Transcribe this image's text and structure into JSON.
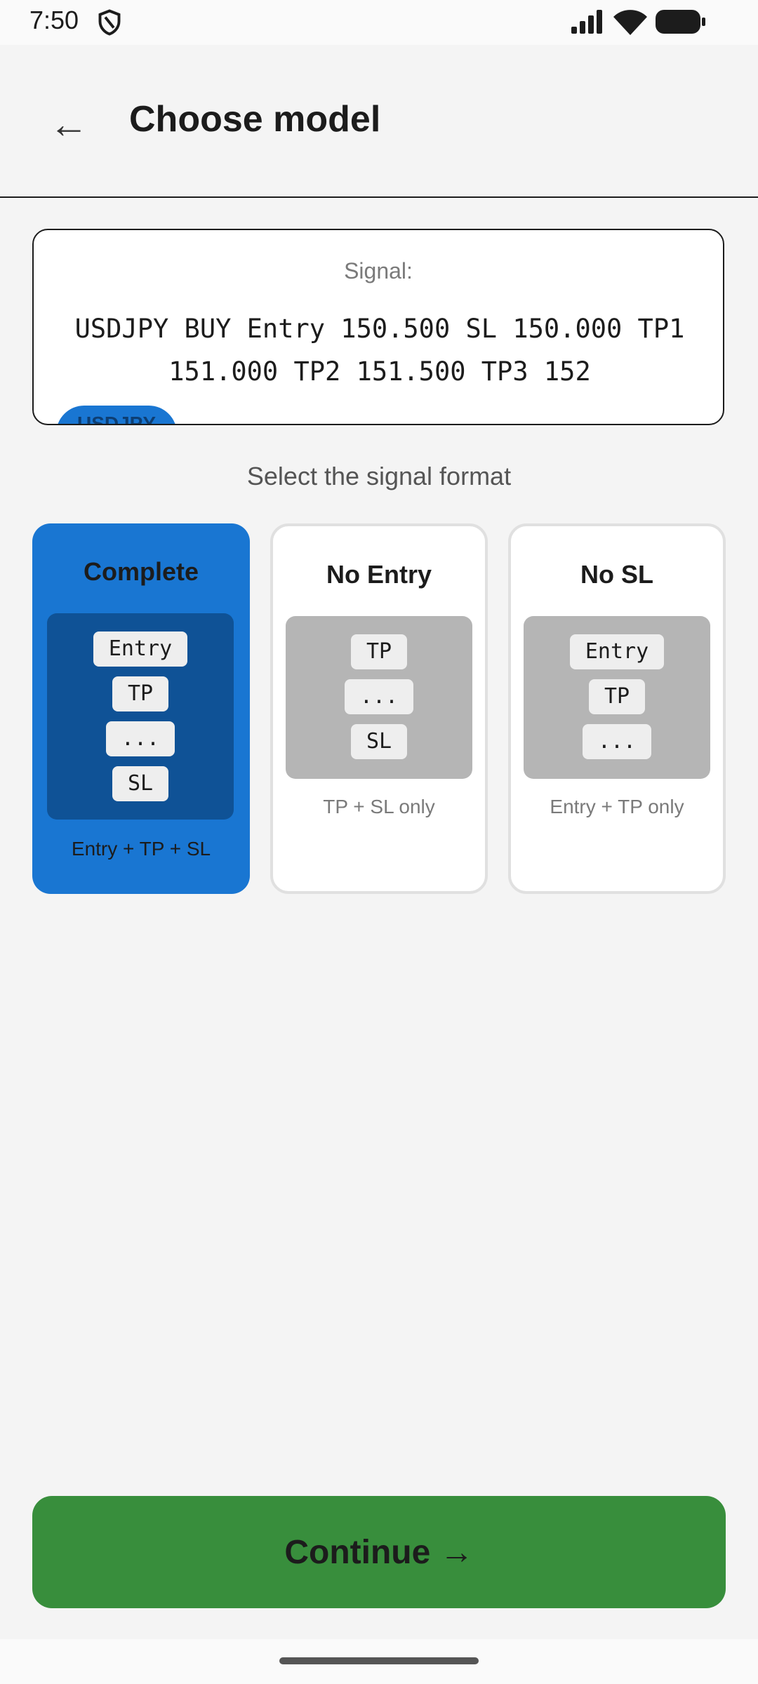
{
  "status_bar": {
    "time": "7:50"
  },
  "app_bar": {
    "back_glyph": "←",
    "title": "Choose model"
  },
  "signal": {
    "label": "Signal:",
    "text": "USDJPY BUY Entry 150.500 SL 150.000 TP1 151.000 TP2 151.500 TP3 152",
    "pair_chip": "USDJPY"
  },
  "format_prompt": "Select the signal format",
  "formats": [
    {
      "title": "Complete",
      "chips": [
        "Entry",
        "TP",
        "...",
        "SL"
      ],
      "caption": "Entry + TP + SL",
      "selected": true
    },
    {
      "title": "No Entry",
      "chips": [
        "TP",
        "...",
        "SL"
      ],
      "caption": "TP + SL only",
      "selected": false
    },
    {
      "title": "No SL",
      "chips": [
        "Entry",
        "TP",
        "..."
      ],
      "caption": "Entry + TP only",
      "selected": false
    }
  ],
  "continue_label": "Continue →",
  "colors": {
    "accent": "#1976d2",
    "accent_dark": "#0f5296",
    "primary_action": "#388e3c"
  }
}
